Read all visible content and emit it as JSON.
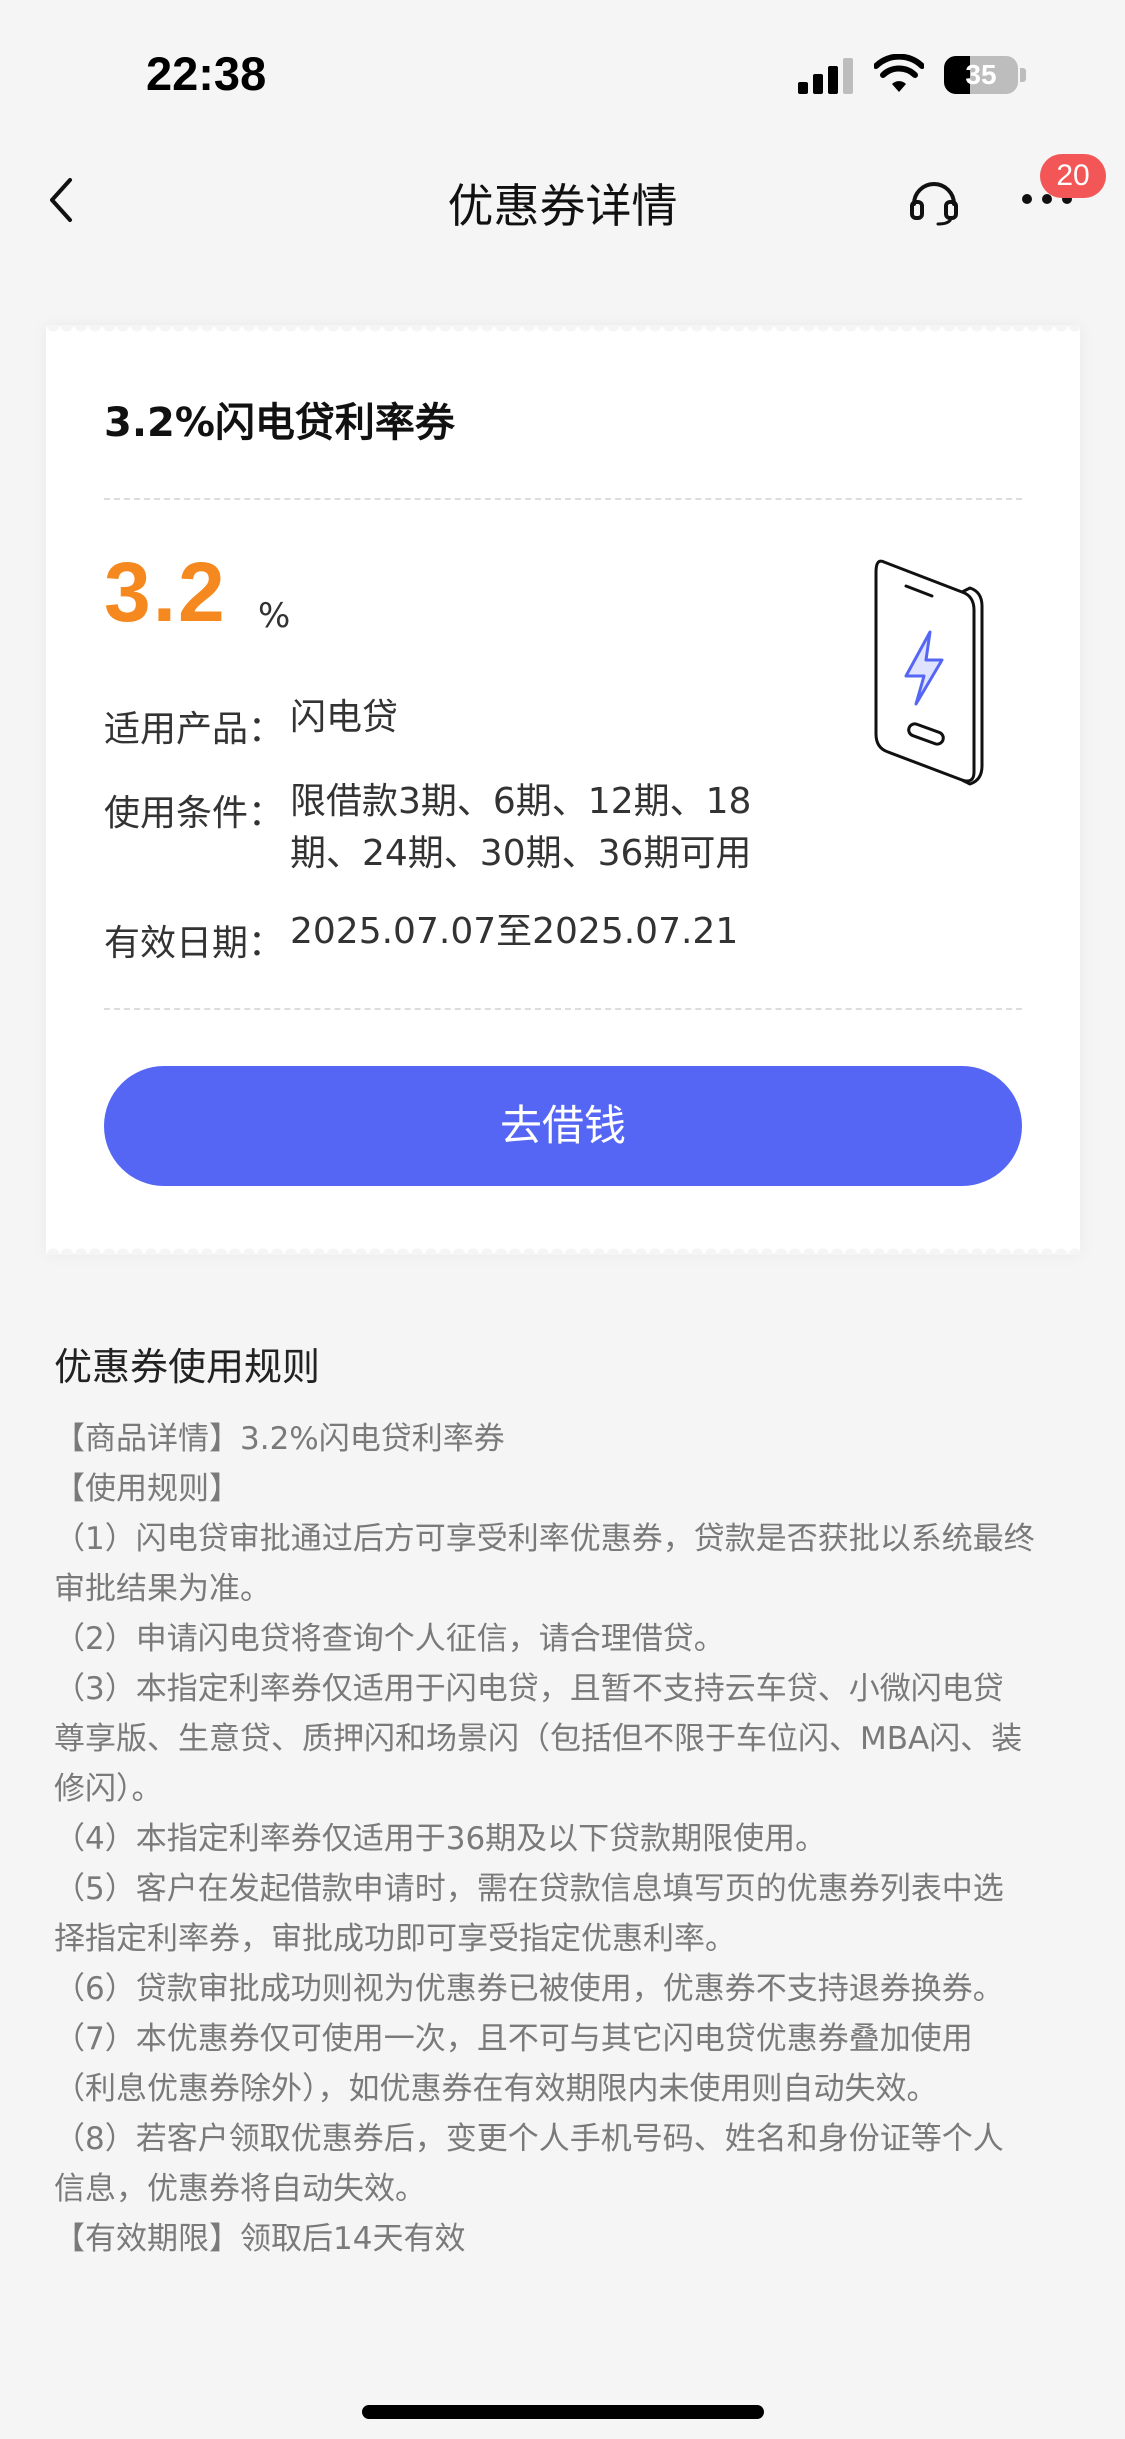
{
  "status_bar": {
    "time": "22:38",
    "battery_level": "35"
  },
  "nav": {
    "title": "优惠券详情",
    "badge_count": "20"
  },
  "coupon": {
    "name": "3.2%闪电贷利率券",
    "rate_value": "3.2",
    "rate_unit": "%",
    "rows": [
      {
        "label": "适用产品：",
        "value": "闪电贷"
      },
      {
        "label": "使用条件：",
        "value": "限借款3期、6期、12期、18期、24期、30期、36期可用"
      },
      {
        "label": "有效日期：",
        "value": "2025.07.07至2025.07.21"
      }
    ],
    "cta_label": "去借钱"
  },
  "rules": {
    "title": "优惠券使用规则",
    "lines": [
      "【商品详情】3.2%闪电贷利率券",
      "【使用规则】",
      "（1）闪电贷审批通过后方可享受利率优惠券，贷款是否获批以系统最终",
      "审批结果为准。",
      "（2）申请闪电贷将查询个人征信，请合理借贷。",
      "（3）本指定利率券仅适用于闪电贷，且暂不支持云车贷、小微闪电贷",
      "尊享版、生意贷、质押闪和场景闪（包括但不限于车位闪、MBA闪、装",
      "修闪）。",
      "（4）本指定利率券仅适用于36期及以下贷款期限使用。",
      "（5）客户在发起借款申请时，需在贷款信息填写页的优惠券列表中选",
      "择指定利率券，审批成功即可享受指定优惠利率。",
      "（6）贷款审批成功则视为优惠券已被使用，优惠券不支持退券换券。",
      "（7）本优惠券仅可使用一次，且不可与其它闪电贷优惠券叠加使用",
      "（利息优惠券除外），如优惠券在有效期限内未使用则自动失效。",
      "（8）若客户领取优惠券后，变更个人手机号码、姓名和身份证等个人",
      "信息，优惠券将自动失效。",
      "【有效期限】领取后14天有效"
    ]
  },
  "colors": {
    "accent_orange": "#f5891f",
    "button_blue": "#5566f5",
    "badge_red": "#f25656",
    "page_bg": "#f5f5f5"
  },
  "icons": [
    "back-icon",
    "headset-icon",
    "more-icon",
    "signal-icon",
    "wifi-icon",
    "battery-icon",
    "phone-lightning-illustration"
  ]
}
